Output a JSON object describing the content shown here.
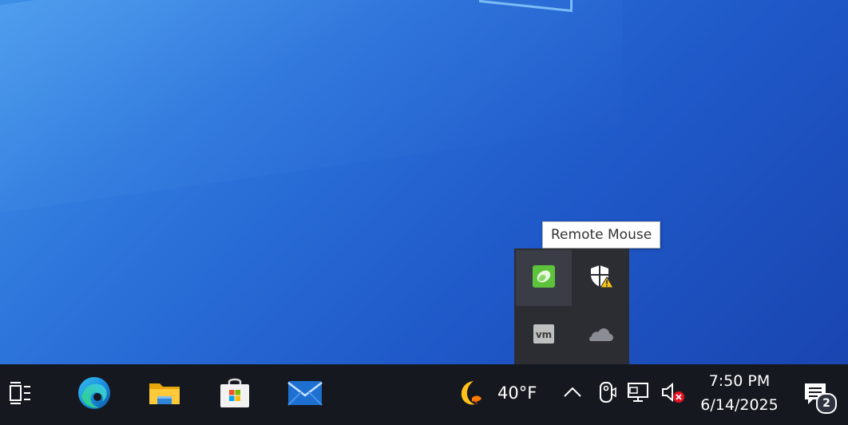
{
  "tooltip": {
    "text": "Remote Mouse"
  },
  "tray_overflow": {
    "items": [
      {
        "icon": "remote-mouse-icon"
      },
      {
        "icon": "windows-security-warning-icon"
      },
      {
        "icon": "vmware-icon"
      },
      {
        "icon": "onedrive-icon"
      }
    ]
  },
  "taskbar": {
    "pinned": [
      {
        "icon": "task-view-icon"
      },
      {
        "icon": "edge-icon"
      },
      {
        "icon": "file-explorer-icon"
      },
      {
        "icon": "microsoft-store-icon"
      },
      {
        "icon": "mail-icon"
      }
    ],
    "weather": {
      "icon": "moon-icon",
      "temperature": "40°F"
    },
    "system_icons": [
      "chevron-up-icon",
      "meet-now-icon",
      "network-icon",
      "volume-muted-icon"
    ],
    "clock": {
      "time": "7:50 PM",
      "date": "6/14/2025"
    },
    "notifications": {
      "count": "2"
    }
  },
  "colors": {
    "taskbar": "#15191f",
    "flyout": "#2b2d33",
    "remote_mouse_green": "#5cc33a"
  }
}
